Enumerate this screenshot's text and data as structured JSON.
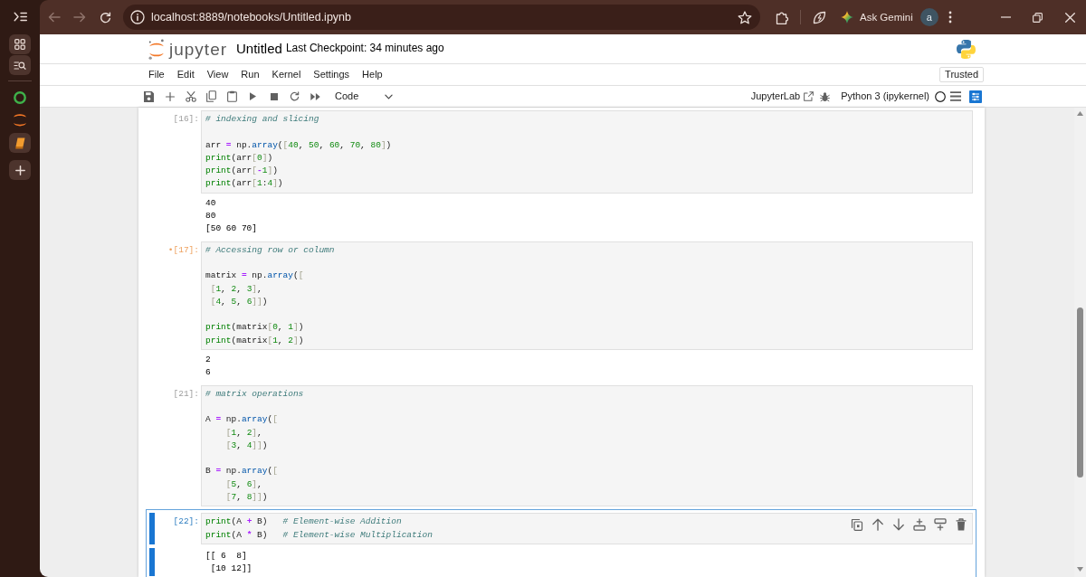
{
  "browser": {
    "back": {
      "disabled": true
    },
    "forward": {
      "disabled": true
    },
    "url": "localhost:8889/notebooks/Untitled.ipynb",
    "assistant_label": "Ask Gemini",
    "avatar_letter": "a"
  },
  "vertical_tabs": [
    {
      "kind": "ring",
      "selected": false
    },
    {
      "kind": "jupyter",
      "selected": false
    },
    {
      "kind": "book",
      "selected": true
    }
  ],
  "header": {
    "logo_text": "jupyter",
    "title": "Untitled",
    "checkpoint": "Last Checkpoint: 34 minutes ago",
    "trusted_label": "Trusted"
  },
  "menu": [
    "File",
    "Edit",
    "View",
    "Run",
    "Kernel",
    "Settings",
    "Help"
  ],
  "toolbar": {
    "cell_type": "Code",
    "open_in_label": "JupyterLab",
    "kernel": {
      "name": "Python 3 (ipykernel)",
      "busy": false
    }
  },
  "cells": [
    {
      "prompt": "[16]:",
      "modified": false,
      "selected": false,
      "source": [
        [
          [
            {
              "kind": "comment",
              "text": "# indexing and slicing"
            }
          ]
        ],
        [
          [
            {
              "kind": "plain",
              "text": "arr "
            },
            {
              "kind": "operator",
              "text": "="
            },
            {
              "kind": "plain",
              "text": " np."
            },
            {
              "kind": "property",
              "text": "array"
            },
            {
              "kind": "plain",
              "text": "("
            },
            {
              "kind": "bracket",
              "text": "["
            },
            {
              "kind": "number",
              "text": "40"
            },
            {
              "kind": "plain",
              "text": ", "
            },
            {
              "kind": "number",
              "text": "50"
            },
            {
              "kind": "plain",
              "text": ", "
            },
            {
              "kind": "number",
              "text": "60"
            },
            {
              "kind": "plain",
              "text": ", "
            },
            {
              "kind": "number",
              "text": "70"
            },
            {
              "kind": "plain",
              "text": ", "
            },
            {
              "kind": "number",
              "text": "80"
            },
            {
              "kind": "bracket",
              "text": "]"
            },
            {
              "kind": "plain",
              "text": ")"
            }
          ],
          [
            {
              "kind": "builtin",
              "text": "print"
            },
            {
              "kind": "plain",
              "text": "(arr"
            },
            {
              "kind": "bracket",
              "text": "["
            },
            {
              "kind": "number",
              "text": "0"
            },
            {
              "kind": "bracket",
              "text": "]"
            },
            {
              "kind": "plain",
              "text": ")"
            }
          ],
          [
            {
              "kind": "builtin",
              "text": "print"
            },
            {
              "kind": "plain",
              "text": "(arr"
            },
            {
              "kind": "bracket",
              "text": "["
            },
            {
              "kind": "operator",
              "text": "-"
            },
            {
              "kind": "number",
              "text": "1"
            },
            {
              "kind": "bracket",
              "text": "]"
            },
            {
              "kind": "plain",
              "text": ")"
            }
          ],
          [
            {
              "kind": "builtin",
              "text": "print"
            },
            {
              "kind": "plain",
              "text": "(arr"
            },
            {
              "kind": "bracket",
              "text": "["
            },
            {
              "kind": "number",
              "text": "1"
            },
            {
              "kind": "plain",
              "text": ":"
            },
            {
              "kind": "number",
              "text": "4"
            },
            {
              "kind": "bracket",
              "text": "]"
            },
            {
              "kind": "plain",
              "text": ")"
            }
          ]
        ]
      ],
      "output": [
        "40",
        "80",
        "[50 60 70]"
      ]
    },
    {
      "prompt": "•[17]:",
      "modified": true,
      "selected": false,
      "source": [
        [
          [
            {
              "kind": "comment",
              "text": "# Accessing row or column"
            }
          ]
        ],
        [
          [
            {
              "kind": "plain",
              "text": "matrix "
            },
            {
              "kind": "operator",
              "text": "="
            },
            {
              "kind": "plain",
              "text": " np."
            },
            {
              "kind": "property",
              "text": "array"
            },
            {
              "kind": "plain",
              "text": "("
            },
            {
              "kind": "bracket",
              "text": "["
            }
          ],
          [
            {
              "kind": "bracket",
              "text": " ["
            },
            {
              "kind": "number",
              "text": "1"
            },
            {
              "kind": "plain",
              "text": ", "
            },
            {
              "kind": "number",
              "text": "2"
            },
            {
              "kind": "plain",
              "text": ", "
            },
            {
              "kind": "number",
              "text": "3"
            },
            {
              "kind": "bracket",
              "text": "]"
            },
            {
              "kind": "plain",
              "text": ","
            }
          ],
          [
            {
              "kind": "bracket",
              "text": " ["
            },
            {
              "kind": "number",
              "text": "4"
            },
            {
              "kind": "plain",
              "text": ", "
            },
            {
              "kind": "number",
              "text": "5"
            },
            {
              "kind": "plain",
              "text": ", "
            },
            {
              "kind": "number",
              "text": "6"
            },
            {
              "kind": "bracket",
              "text": "]]"
            },
            {
              "kind": "plain",
              "text": ")"
            }
          ]
        ],
        [
          [
            {
              "kind": "builtin",
              "text": "print"
            },
            {
              "kind": "plain",
              "text": "(matrix"
            },
            {
              "kind": "bracket",
              "text": "["
            },
            {
              "kind": "number",
              "text": "0"
            },
            {
              "kind": "plain",
              "text": ", "
            },
            {
              "kind": "number",
              "text": "1"
            },
            {
              "kind": "bracket",
              "text": "]"
            },
            {
              "kind": "plain",
              "text": ")"
            }
          ],
          [
            {
              "kind": "builtin",
              "text": "print"
            },
            {
              "kind": "plain",
              "text": "(matrix"
            },
            {
              "kind": "bracket",
              "text": "["
            },
            {
              "kind": "number",
              "text": "1"
            },
            {
              "kind": "plain",
              "text": ", "
            },
            {
              "kind": "number",
              "text": "2"
            },
            {
              "kind": "bracket",
              "text": "]"
            },
            {
              "kind": "plain",
              "text": ")"
            }
          ]
        ]
      ],
      "output": [
        "2",
        "6"
      ]
    },
    {
      "prompt": "[21]:",
      "modified": false,
      "selected": false,
      "source": [
        [
          [
            {
              "kind": "comment",
              "text": "# matrix operations"
            }
          ]
        ],
        [
          [
            {
              "kind": "plain",
              "text": "A "
            },
            {
              "kind": "operator",
              "text": "="
            },
            {
              "kind": "plain",
              "text": " np."
            },
            {
              "kind": "property",
              "text": "array"
            },
            {
              "kind": "plain",
              "text": "("
            },
            {
              "kind": "bracket",
              "text": "["
            }
          ],
          [
            {
              "kind": "bracket",
              "text": "    ["
            },
            {
              "kind": "number",
              "text": "1"
            },
            {
              "kind": "plain",
              "text": ", "
            },
            {
              "kind": "number",
              "text": "2"
            },
            {
              "kind": "bracket",
              "text": "]"
            },
            {
              "kind": "plain",
              "text": ","
            }
          ],
          [
            {
              "kind": "bracket",
              "text": "    ["
            },
            {
              "kind": "number",
              "text": "3"
            },
            {
              "kind": "plain",
              "text": ", "
            },
            {
              "kind": "number",
              "text": "4"
            },
            {
              "kind": "bracket",
              "text": "]]"
            },
            {
              "kind": "plain",
              "text": ")"
            }
          ]
        ],
        [
          [
            {
              "kind": "plain",
              "text": "B "
            },
            {
              "kind": "operator",
              "text": "="
            },
            {
              "kind": "plain",
              "text": " np."
            },
            {
              "kind": "property",
              "text": "array"
            },
            {
              "kind": "plain",
              "text": "("
            },
            {
              "kind": "bracket",
              "text": "["
            }
          ],
          [
            {
              "kind": "bracket",
              "text": "    ["
            },
            {
              "kind": "number",
              "text": "5"
            },
            {
              "kind": "plain",
              "text": ", "
            },
            {
              "kind": "number",
              "text": "6"
            },
            {
              "kind": "bracket",
              "text": "]"
            },
            {
              "kind": "plain",
              "text": ","
            }
          ],
          [
            {
              "kind": "bracket",
              "text": "    ["
            },
            {
              "kind": "number",
              "text": "7"
            },
            {
              "kind": "plain",
              "text": ", "
            },
            {
              "kind": "number",
              "text": "8"
            },
            {
              "kind": "bracket",
              "text": "]]"
            },
            {
              "kind": "plain",
              "text": ")"
            }
          ]
        ]
      ]
    },
    {
      "prompt": "[22]:",
      "modified": false,
      "selected": true,
      "source": [
        [
          [
            {
              "kind": "builtin",
              "text": "print"
            },
            {
              "kind": "plain",
              "text": "(A "
            },
            {
              "kind": "operator",
              "text": "+"
            },
            {
              "kind": "plain",
              "text": " B)   "
            },
            {
              "kind": "comment",
              "text": "# Element-wise Addition"
            }
          ],
          [
            {
              "kind": "builtin",
              "text": "print"
            },
            {
              "kind": "plain",
              "text": "(A "
            },
            {
              "kind": "operator",
              "text": "*"
            },
            {
              "kind": "plain",
              "text": " B)   "
            },
            {
              "kind": "comment",
              "text": "# Element-wise Multiplication"
            }
          ]
        ]
      ],
      "output": [
        "[[ 6  8]",
        " [10 12]]"
      ]
    }
  ]
}
